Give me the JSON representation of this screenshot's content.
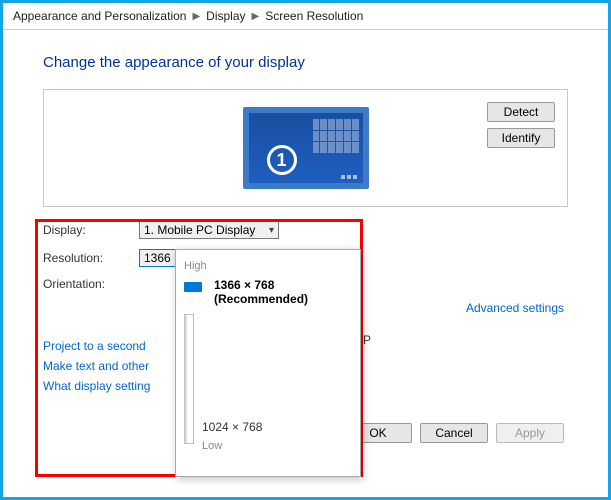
{
  "breadcrumb": {
    "a": "Appearance and Personalization",
    "b": "Display",
    "c": "Screen Resolution"
  },
  "heading": "Change the appearance of your display",
  "monitor_number": "1",
  "buttons": {
    "detect": "Detect",
    "identify": "Identify",
    "ok": "OK",
    "cancel": "Cancel",
    "apply": "Apply"
  },
  "fields": {
    "display_label": "Display:",
    "display_value": "1. Mobile PC Display",
    "resolution_label": "Resolution:",
    "resolution_value": "1366 × 768 (Recommended)",
    "orientation_label": "Orientation:"
  },
  "advanced": "Advanced settings",
  "links": {
    "project": "Project to a second",
    "text": "Make text and other",
    "what": "What display setting"
  },
  "popup": {
    "high": "High",
    "selected": "1366 × 768 (Recommended)",
    "low_res": "1024 × 768",
    "low": "Low"
  },
  "truncated_p": "P"
}
